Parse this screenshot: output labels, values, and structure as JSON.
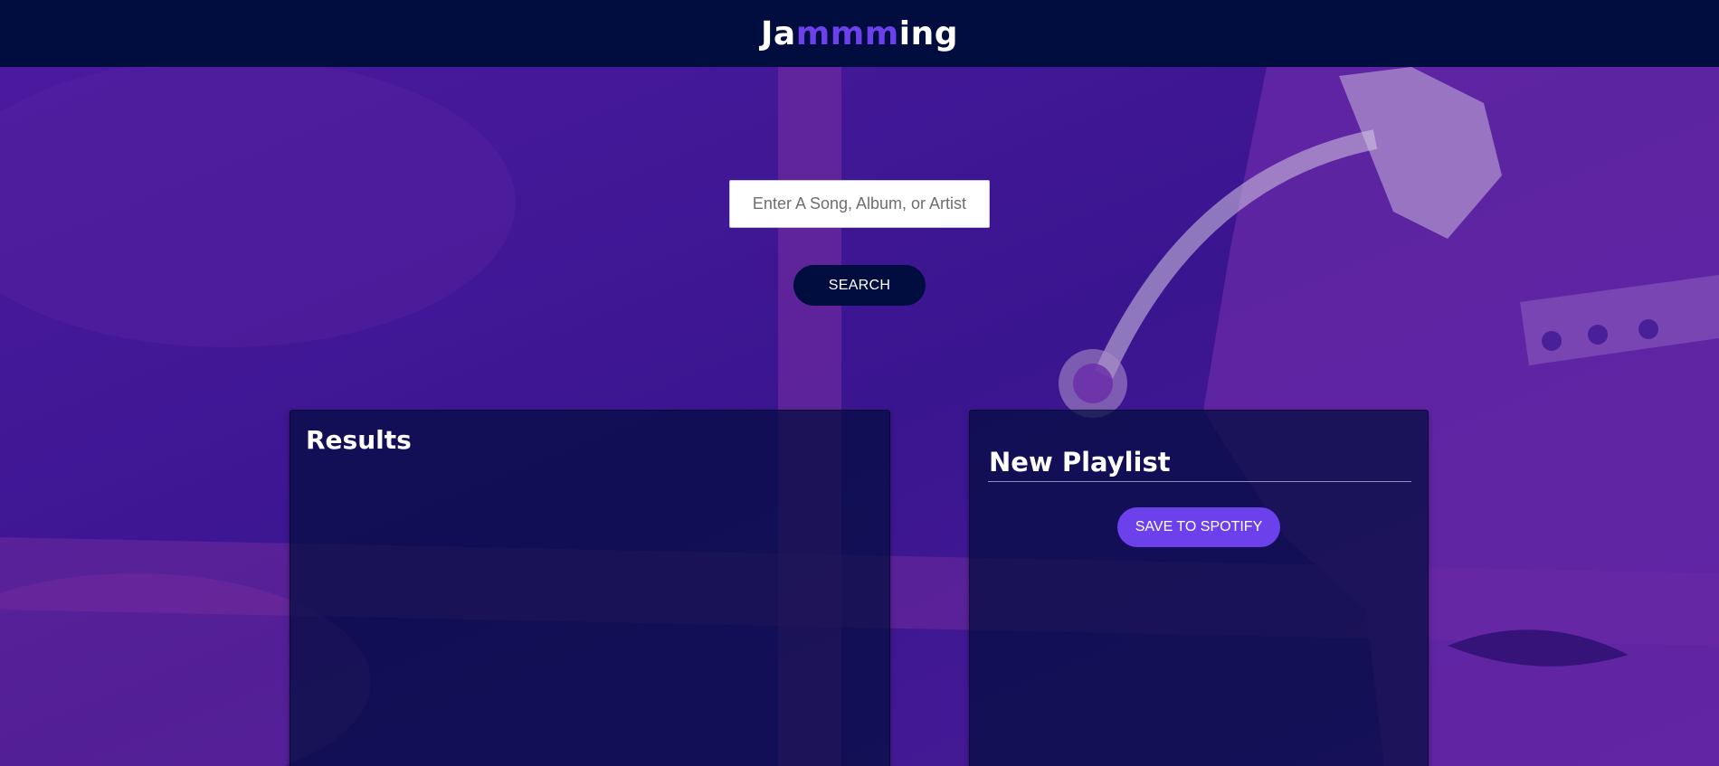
{
  "app": {
    "logo_prefix": "Ja",
    "logo_accent": "mmm",
    "logo_suffix": "ing"
  },
  "search": {
    "placeholder": "Enter A Song, Album, or Artist",
    "value": "",
    "button_label": "SEARCH"
  },
  "results": {
    "title": "Results",
    "tracks": []
  },
  "playlist": {
    "name": "New Playlist",
    "save_label": "SAVE TO SPOTIFY",
    "tracks": []
  },
  "colors": {
    "header_bg": "#010c3f",
    "accent": "#6c41ec",
    "background_purple": "#3d1694",
    "panel_bg": "#010c3f"
  }
}
